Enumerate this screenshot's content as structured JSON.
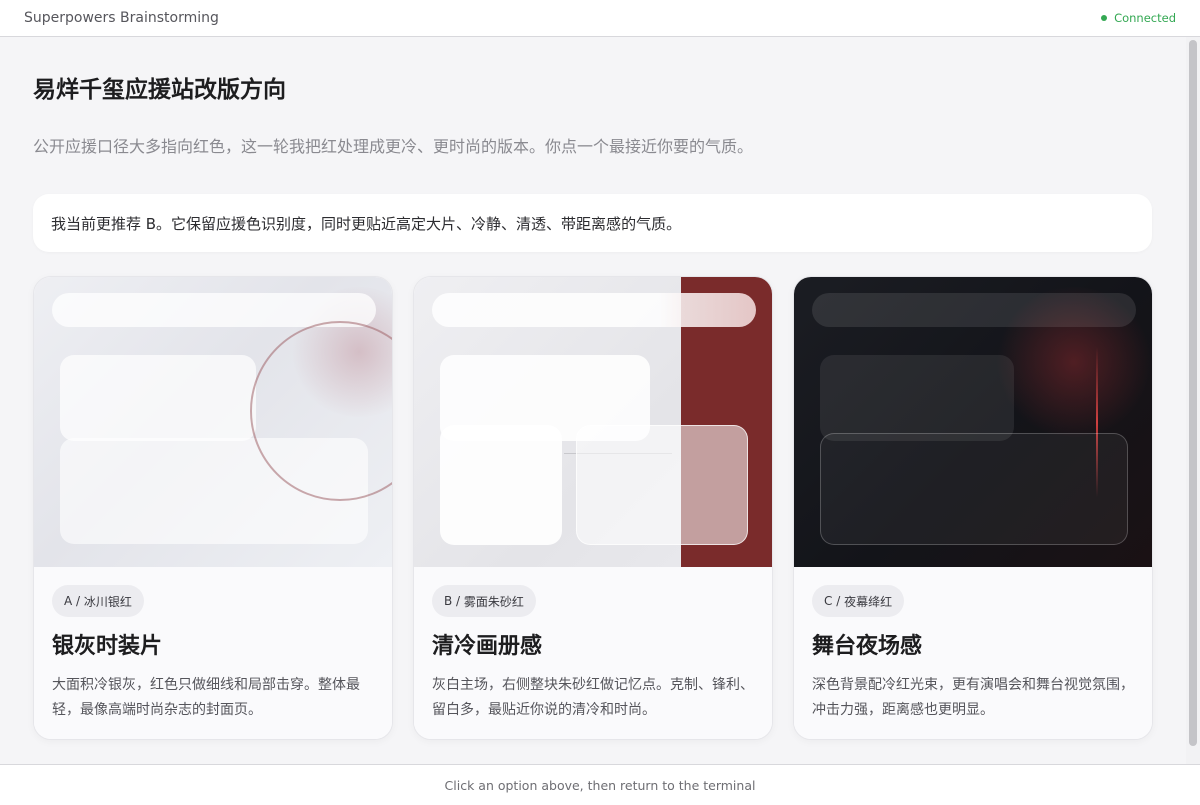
{
  "app": {
    "title": "Superpowers Brainstorming",
    "status": "Connected",
    "status_color": "#34a853"
  },
  "main": {
    "title": "易烊千玺应援站改版方向",
    "subtitle": "公开应援口径大多指向红色，这一轮我把红处理成更冷、更时尚的版本。你点一个最接近你要的气质。",
    "recommendation": "我当前更推荐 B。它保留应援色识别度，同时更贴近高定大片、冷静、清透、带距离感的气质。"
  },
  "options": [
    {
      "letter": "A",
      "name": "冰川银红",
      "title": "银灰时装片",
      "description": "大面积冷银灰，红色只做细线和局部击穿。整体最轻，最像高端时尚杂志的封面页。"
    },
    {
      "letter": "B",
      "name": "雾面朱砂红",
      "title": "清冷画册感",
      "description": "灰白主场，右侧整块朱砂红做记忆点。克制、锋利、留白多，最贴近你说的清冷和时尚。"
    },
    {
      "letter": "C",
      "name": "夜幕绛红",
      "title": "舞台夜场感",
      "description": "深色背景配冷红光束，更有演唱会和舞台视觉氛围，冲击力强，距离感也更明显。"
    }
  ],
  "footer": {
    "hint": "Click an option above, then return to the terminal"
  },
  "colors": {
    "cinnabar": "#7a2b2b",
    "night": "#131419"
  }
}
